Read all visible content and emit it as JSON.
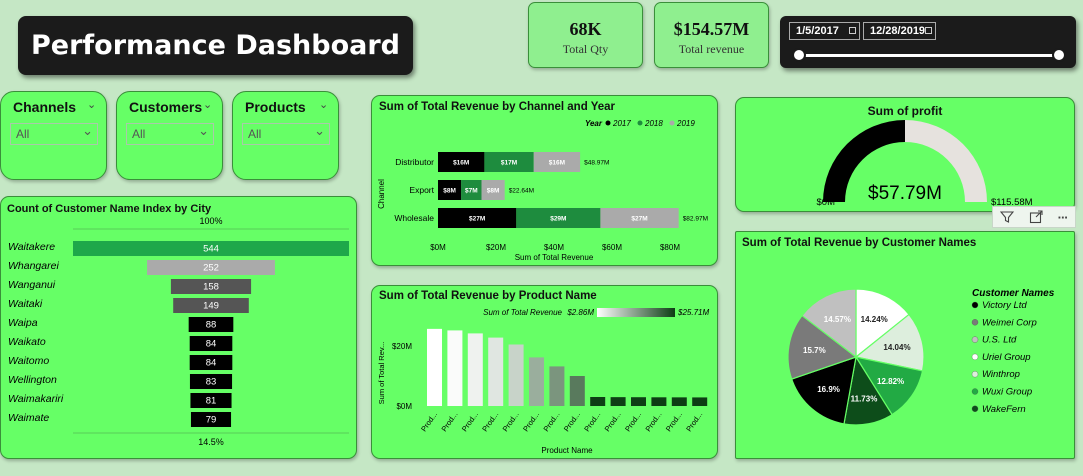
{
  "title": "Performance Dashboard",
  "kpis": [
    {
      "value": "68K",
      "label": "Total Qty"
    },
    {
      "value": "$154.57M",
      "label": "Total revenue"
    }
  ],
  "date_range": {
    "start": "1/5/2017",
    "end": "12/28/2019"
  },
  "slicers": [
    {
      "label": "Channels",
      "value": "All"
    },
    {
      "label": "Customers",
      "value": "All"
    },
    {
      "label": "Products",
      "value": "All"
    }
  ],
  "icons": {
    "slicer_chevron": "chevron-down-icon",
    "calendar": "calendar-icon",
    "filter": "filter-icon",
    "focus": "focus-mode-icon",
    "more": "more-options-icon"
  },
  "visual_header": {
    "more_label": "···"
  },
  "colors": {
    "background": "#c5e7c5",
    "card": "#66ff66",
    "dark": "#111111",
    "green": "#1e8c3e",
    "light_grey": "#aaaaaa",
    "funnel_top": "#1ea84a"
  },
  "chart_data": [
    {
      "id": "city_funnel",
      "type": "funnel",
      "title": "Count of Customer Name Index by City",
      "top_label": "100%",
      "bottom_label": "14.5%",
      "categories": [
        "Waitakere",
        "Whangarei",
        "Wanganui",
        "Waitaki",
        "Waipa",
        "Waikato",
        "Waitomo",
        "Wellington",
        "Waimakariri",
        "Waimate"
      ],
      "values": [
        544,
        252,
        158,
        149,
        88,
        84,
        84,
        83,
        81,
        79
      ]
    },
    {
      "id": "channel_year",
      "type": "bar",
      "orientation": "horizontal",
      "stacked": true,
      "title": "Sum of Total Revenue by Channel and Year",
      "legend_title": "Year",
      "legend_position": "top-right",
      "ylabel": "Channel",
      "xlabel": "Sum of Total Revenue",
      "categories": [
        "Distributor",
        "Export",
        "Wholesale"
      ],
      "series": [
        {
          "name": "2017",
          "color": "#000000",
          "values": [
            16,
            8,
            27
          ],
          "labels": [
            "$16M",
            "$8M",
            "$27M"
          ]
        },
        {
          "name": "2018",
          "color": "#1e8c3e",
          "values": [
            17,
            7,
            29
          ],
          "labels": [
            "$17M",
            "$7M",
            "$29M"
          ]
        },
        {
          "name": "2019",
          "color": "#aaaaaa",
          "values": [
            16,
            8,
            27
          ],
          "labels": [
            "$16M",
            "$8M",
            "$27M"
          ]
        }
      ],
      "totals": [
        "$48.97M",
        "$22.64M",
        "$82.97M"
      ],
      "xticks": [
        0,
        20,
        40,
        60,
        80
      ],
      "xtick_labels": [
        "$0M",
        "$20M",
        "$40M",
        "$60M",
        "$80M"
      ],
      "xlim": [
        0,
        90
      ]
    },
    {
      "id": "profit_gauge",
      "type": "gauge",
      "title": "Sum of profit",
      "value": 57.79,
      "value_label": "$57.79M",
      "min": 0,
      "min_label": "$0M",
      "max": 115.58,
      "max_label": "$115.58M"
    },
    {
      "id": "product_revenue",
      "type": "bar",
      "title": "Sum of Total Revenue by Product Name",
      "gradient_legend_title": "Sum of Total Revenue",
      "gradient_min_label": "$2.86M",
      "gradient_max_label": "$25.71M",
      "ylabel": "Sum of Total Rev...",
      "xlabel": "Product Name",
      "categories": [
        "Prod...",
        "Prod...",
        "Prod...",
        "Prod...",
        "Prod...",
        "Prod...",
        "Prod...",
        "Prod...",
        "Prod...",
        "Prod...",
        "Prod...",
        "Prod...",
        "Prod...",
        "Prod..."
      ],
      "values": [
        25.71,
        25.2,
        24.2,
        22.8,
        20.5,
        16.2,
        13.2,
        10.0,
        3.0,
        2.95,
        2.93,
        2.9,
        2.88,
        2.86
      ],
      "yticks": [
        0,
        20
      ],
      "ytick_labels": [
        "$0M",
        "$20M"
      ],
      "ylim": [
        0,
        28
      ]
    },
    {
      "id": "customer_pie",
      "type": "pie",
      "title": "Sum of Total Revenue by Customer Names",
      "legend_title": "Customer Names",
      "legend_position": "right",
      "slices": [
        {
          "name": "Victory Ltd",
          "value": 16.9,
          "label": "16.9%",
          "color": "#000000"
        },
        {
          "name": "Weimei Corp",
          "value": 15.7,
          "label": "15.7%",
          "color": "#7a7a7a"
        },
        {
          "name": "U.S. Ltd",
          "value": 14.57,
          "label": "14.57%",
          "color": "#c0c0c0"
        },
        {
          "name": "Uriel Group",
          "value": 14.24,
          "label": "14.24%",
          "color": "#ffffff"
        },
        {
          "name": "Winthrop",
          "value": 14.04,
          "label": "14.04%",
          "color": "#ddeedd"
        },
        {
          "name": "Wuxi Group",
          "value": 12.82,
          "label": "12.82%",
          "color": "#22aa44"
        },
        {
          "name": "WakeFern",
          "value": 11.73,
          "label": "11.73%",
          "color": "#0d4d1a"
        }
      ]
    }
  ]
}
